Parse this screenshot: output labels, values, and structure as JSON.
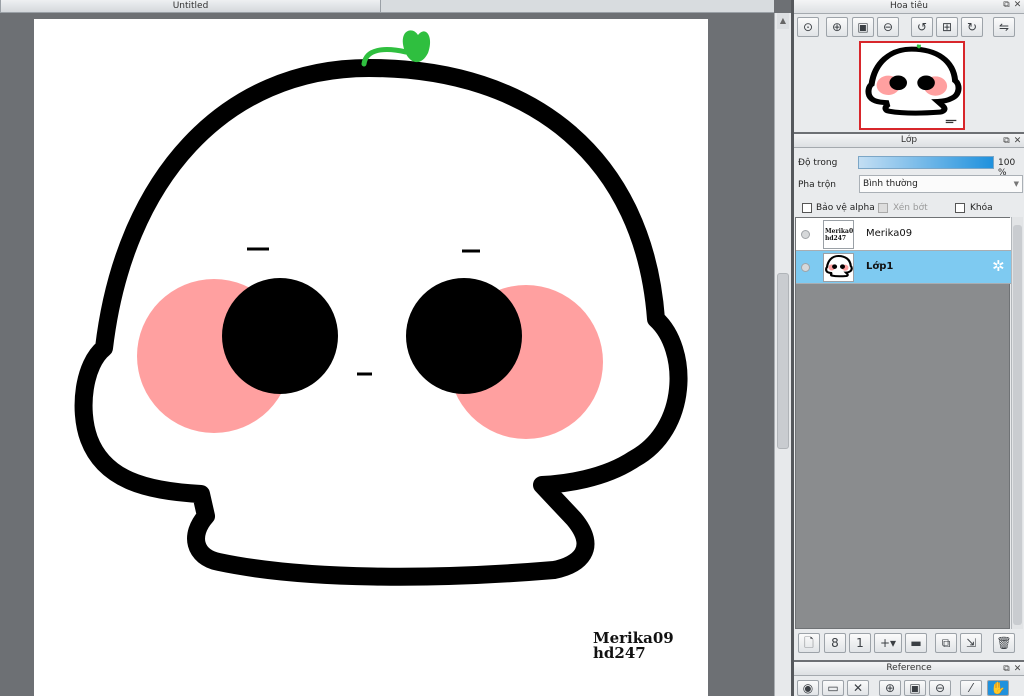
{
  "document": {
    "tab_title": "Untitled",
    "signature_line1": "Merika09",
    "signature_line2": "hd247"
  },
  "navigator": {
    "title": "Hoa tiêu",
    "tools": [
      "zoom-fit-icon",
      "zoom-in-icon",
      "fit-screen-icon",
      "zoom-out-icon",
      "rotate-left-icon",
      "actual-size-icon",
      "rotate-right-icon",
      "flip-icon"
    ]
  },
  "layers": {
    "title": "Lớp",
    "opacity_label": "Độ trong",
    "opacity_value": "100 %",
    "opacity": 1.0,
    "blend_label": "Pha trộn",
    "blend_value": "Bình thường",
    "protect_alpha": "Bảo vệ alpha",
    "clipping": "Xén bớt",
    "lock": "Khóa",
    "items": [
      {
        "name": "Merika09",
        "thumb_line1": "Merika09",
        "thumb_line2": "hd247",
        "selected": false
      },
      {
        "name": "Lớp1",
        "selected": true
      }
    ]
  },
  "reference": {
    "title": "Reference"
  },
  "colors": {
    "accent": "#1f91dd",
    "selected_layer": "#7ecaf1",
    "cheek": "#ffa0a0",
    "sprout": "#2fbf3f",
    "outline": "#000000"
  }
}
